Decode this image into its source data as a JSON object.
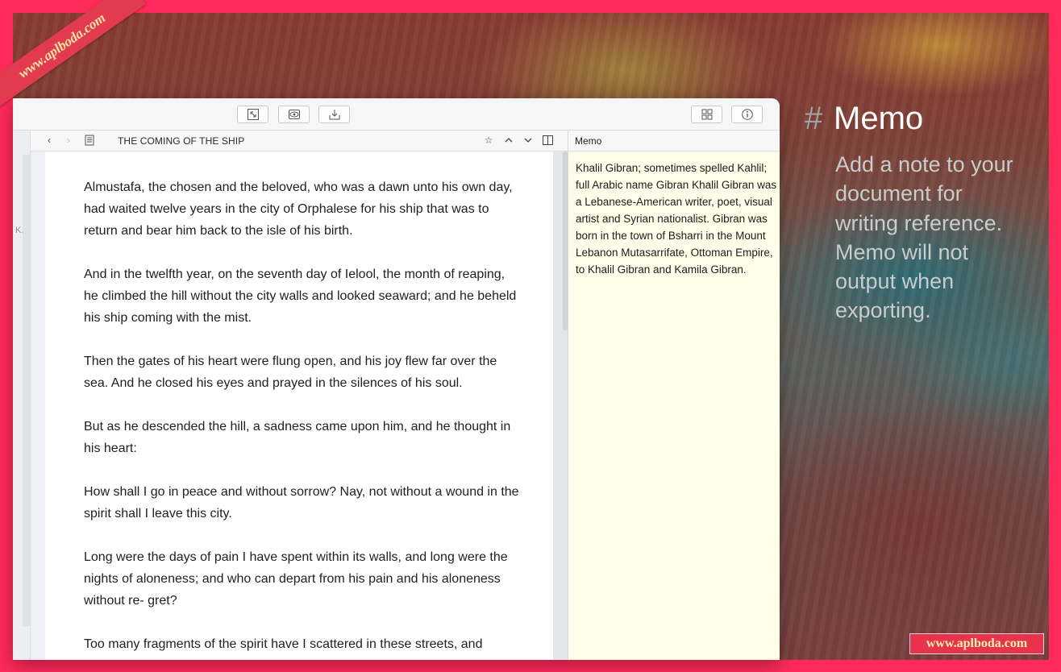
{
  "watermark": {
    "ribbon_text": "www.aplboda.com",
    "bottom_text": "www.aplboda.com"
  },
  "toolbar": {
    "buttons": [
      {
        "icon": "expand-icon"
      },
      {
        "icon": "eye-icon"
      },
      {
        "icon": "download-icon"
      },
      {
        "icon": "grid-icon"
      },
      {
        "icon": "info-icon"
      }
    ]
  },
  "left_strip": {
    "partial_text": "K."
  },
  "editor": {
    "title": "THE COMING OF THE SHIP",
    "paragraphs": [
      "Almustafa, the chosen and the beloved, who was a dawn unto his own day, had waited twelve years in the city of Orphalese for his ship that was to return and bear him back to the isle of his birth.",
      "And in the twelfth year, on the seventh day of Ielool, the month of reaping, he climbed the hill without the city walls and looked seaward; and he beheld his ship coming with the mist.",
      "Then the gates of his heart were flung open, and his joy flew far over the sea. And he closed his eyes and prayed in the silences of his soul.",
      "But as he descended the hill, a sadness came upon him, and he thought in his heart:",
      "How shall I go in peace and without sorrow? Nay, not without a wound in the spirit shall I leave this city.",
      "Long were the days of pain I have spent within its walls, and long were the nights of aloneness; and who can depart from his pain and his aloneness without re- gret?",
      "Too many fragments of the spirit have I scattered in these streets, and"
    ]
  },
  "memo": {
    "header": "Memo",
    "text": "Khalil Gibran; sometimes spelled Kahlil; full Arabic name Gibran Khalil Gibran was a Lebanese-American writer, poet, visual artist and Syrian nationalist. Gibran was born in the town of Bsharri in the Mount Lebanon Mutasarrifate, Ottoman Empire, to Khalil Gibran and Kamila Gibran."
  },
  "caption": {
    "hash": "#",
    "title": "Memo",
    "body": "Add a note to your document for writing reference. Memo will not output when exporting."
  },
  "colors": {
    "frame": "#ff2a5a",
    "memo_background": "#fefee9",
    "caption_title": "#ffffff",
    "caption_body": "#c8cccc"
  }
}
